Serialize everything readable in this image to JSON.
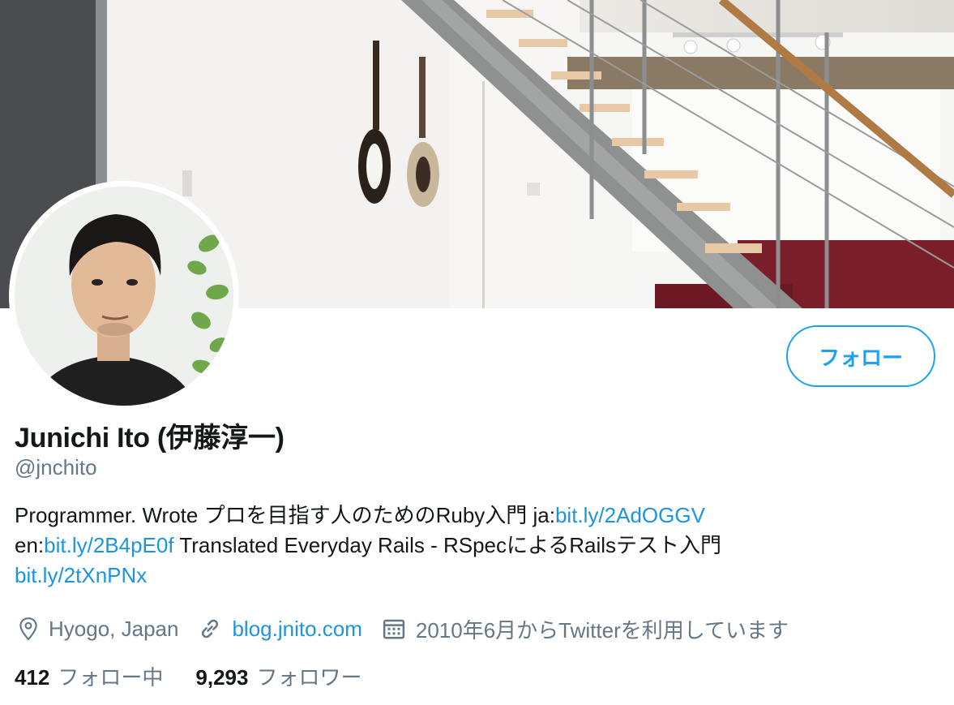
{
  "profile": {
    "display_name": "Junichi Ito (伊藤淳一)",
    "handle": "@jnchito",
    "follow_label": "フォロー",
    "bio": {
      "line1_text": "Programmer. Wrote プロを目指す人のためのRuby入門 ja:",
      "line1_link": "bit.ly/2AdOGGV",
      "line2_prefix": "en:",
      "line2_link": "bit.ly/2B4pE0f",
      "line2_text": " Translated Everyday Rails - RSpecによるRailsテスト入門",
      "line3_link": "bit.ly/2tXnPNx"
    },
    "location": "Hyogo, Japan",
    "website": "blog.jnito.com",
    "joined": "2010年6月からTwitterを利用しています",
    "following_count": "412",
    "following_label": "フォロー中",
    "followers_count": "9,293",
    "followers_label": "フォロワー"
  },
  "icons": {
    "location": "location-pin-icon",
    "website": "link-icon",
    "joined": "calendar-icon"
  },
  "colors": {
    "accent": "#1da1f2",
    "link": "#1b95e0",
    "secondary_text": "#657786",
    "primary_text": "#14171a"
  }
}
